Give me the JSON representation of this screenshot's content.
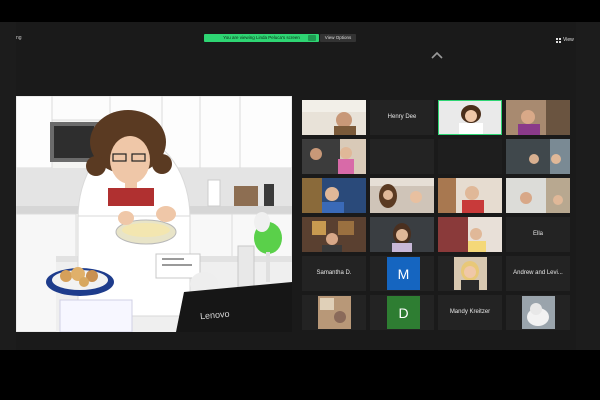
{
  "app": {
    "label": "ng"
  },
  "banner": {
    "sharing_text": "You are viewing Linda Peluca's screen",
    "view_options_label": "View Options"
  },
  "toolbar": {
    "view_label": "View"
  },
  "speaker": {
    "laptop_brand": "Lenovo"
  },
  "gallery": {
    "named_tiles": {
      "henry": "Henry Dee",
      "ella": "Ella",
      "samantha": "Samantha D.",
      "andrew": "Andrew and Levi...",
      "mandy": "Mandy Kreitzer"
    },
    "avatars": {
      "m": {
        "letter": "M",
        "color": "#1565c0"
      },
      "d": {
        "letter": "D",
        "color": "#2e7d32"
      }
    }
  },
  "colors": {
    "accent_green": "#2ed573",
    "tile_bg": "#232323"
  }
}
